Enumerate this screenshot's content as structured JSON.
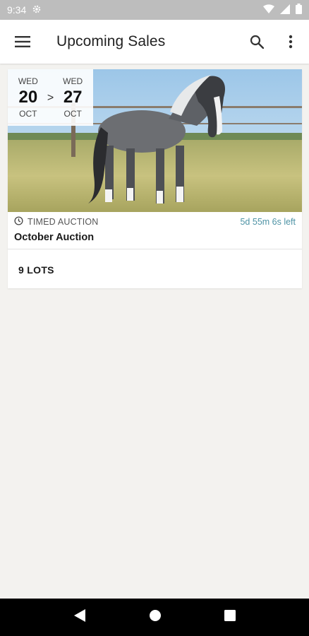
{
  "status_bar": {
    "time": "9:34",
    "icons": [
      "settings-icon",
      "wifi-icon",
      "signal-icon",
      "battery-icon"
    ]
  },
  "app_bar": {
    "title": "Upcoming Sales",
    "icons": [
      "menu-icon",
      "search-icon",
      "more-vert-icon"
    ]
  },
  "sale": {
    "start": {
      "dow": "WED",
      "day": "20",
      "month": "OCT"
    },
    "separator": ">",
    "end": {
      "dow": "WED",
      "day": "27",
      "month": "OCT"
    },
    "type": "TIMED AUCTION",
    "countdown": "5d 55m 6s left",
    "title": "October Auction",
    "lots": "9 LOTS",
    "image": "horse-photo"
  },
  "nav_bar": {
    "icons": [
      "back-icon",
      "home-icon",
      "recents-icon"
    ]
  },
  "colors": {
    "background": "#f3f2ef",
    "status_bar": "#bdbdbd",
    "accent": "#4e93a5"
  }
}
